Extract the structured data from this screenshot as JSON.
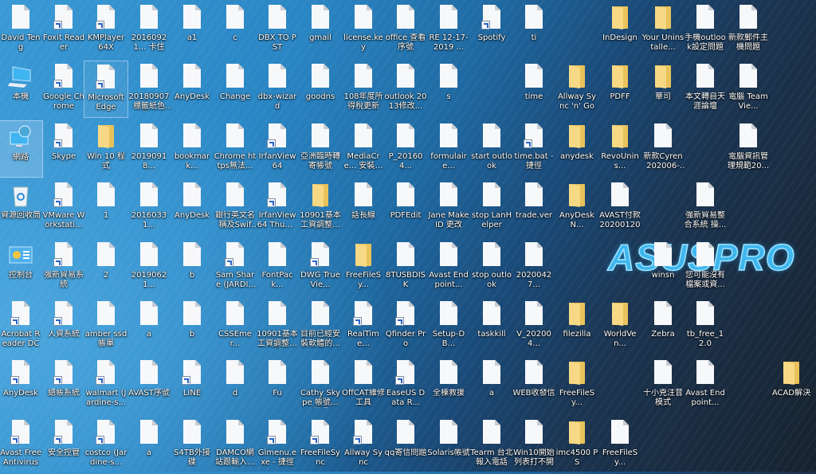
{
  "wallpaper": {
    "logo_text": "ASUSPRO",
    "accent": "#3fb6ee"
  },
  "selected": [
    "網路"
  ],
  "hovered": [
    "Microsoft Edge"
  ],
  "desktop_rows": [
    [
      {
        "label": "David Teng",
        "icon": "file"
      },
      {
        "label": "Foxit Reader",
        "icon": "file",
        "shortcut": true
      },
      {
        "label": "KMPlayer 64X",
        "icon": "file",
        "shortcut": true
      },
      {
        "label": "20160921... 卡住",
        "icon": "file"
      },
      {
        "label": "a1",
        "icon": "file"
      },
      {
        "label": "c",
        "icon": "file"
      },
      {
        "label": "DBX TO PST",
        "icon": "file"
      },
      {
        "label": "gmail",
        "icon": "file"
      },
      {
        "label": "license.key",
        "icon": "file"
      },
      {
        "label": "office 查看序號",
        "icon": "file"
      },
      {
        "label": "RE 12-17-2019 ...",
        "icon": "file"
      },
      {
        "label": "Spotify",
        "icon": "file",
        "shortcut": true
      },
      {
        "label": "ti",
        "icon": "file"
      },
      null,
      {
        "label": "InDesign",
        "icon": "folder"
      },
      {
        "label": "Your Uninstalle...",
        "icon": "folder"
      },
      {
        "label": "手機outlook設定問題",
        "icon": "file"
      },
      {
        "label": "新款郵件主機問題",
        "icon": "file"
      },
      null
    ],
    [
      {
        "label": "本機",
        "icon": "computer"
      },
      {
        "label": "Google Chrome",
        "icon": "file",
        "shortcut": true
      },
      {
        "label": "Microsoft Edge",
        "icon": "file",
        "shortcut": true
      },
      {
        "label": "20180907標籤紙色帶...",
        "icon": "file"
      },
      {
        "label": "AnyDesk",
        "icon": "file"
      },
      {
        "label": "Change",
        "icon": "file"
      },
      {
        "label": "dbx-wizard",
        "icon": "file"
      },
      {
        "label": "goodns",
        "icon": "file"
      },
      {
        "label": "108年度所得稅更新",
        "icon": "file"
      },
      {
        "label": "outlook 2013修改...",
        "icon": "file"
      },
      {
        "label": "s",
        "icon": "file"
      },
      null,
      {
        "label": "time",
        "icon": "file"
      },
      {
        "label": "Allway Sync 'n' Go",
        "icon": "folder"
      },
      {
        "label": "PDFF",
        "icon": "folder"
      },
      {
        "label": "華司",
        "icon": "folder"
      },
      {
        "label": "本文轉自天涯論壇",
        "icon": "file"
      },
      {
        "label": "電腦 TeamVie...",
        "icon": "file"
      },
      null
    ],
    [
      {
        "label": "網路",
        "icon": "network"
      },
      {
        "label": "Skype",
        "icon": "file",
        "shortcut": true
      },
      {
        "label": "Win 10 程式",
        "icon": "folder"
      },
      {
        "label": "20190918...",
        "icon": "file"
      },
      {
        "label": "bookmark...",
        "icon": "file"
      },
      {
        "label": "Chrome https無法...",
        "icon": "file"
      },
      {
        "label": "IrfanView 64",
        "icon": "file",
        "shortcut": true
      },
      {
        "label": "亞洲臨時轉寄帳號",
        "icon": "file"
      },
      {
        "label": "MediaCre... 安裝程式U...",
        "icon": "file"
      },
      {
        "label": "P_201604...",
        "icon": "file"
      },
      {
        "label": "formulaire...",
        "icon": "file"
      },
      {
        "label": "start outlook",
        "icon": "file"
      },
      {
        "label": "time.bat - 捷徑",
        "icon": "file",
        "shortcut": true
      },
      {
        "label": "anydesk",
        "icon": "folder"
      },
      {
        "label": "RevoUnins...",
        "icon": "folder"
      },
      {
        "label": "新款Cyren 202006-2...",
        "icon": "file"
      },
      null,
      {
        "label": "電腦資訊管理規範20...",
        "icon": "file"
      },
      null
    ],
    [
      {
        "label": "資源回收筒",
        "icon": "recycle-bin"
      },
      {
        "label": "VMware Workstati...",
        "icon": "file",
        "shortcut": true
      },
      {
        "label": "1",
        "icon": "file"
      },
      {
        "label": "20160331...",
        "icon": "file"
      },
      {
        "label": "AnyDesk",
        "icon": "file"
      },
      {
        "label": "銀行英文名稱及Swift...",
        "icon": "file"
      },
      {
        "label": "IrfanView 64 Thumbnails",
        "icon": "file",
        "shortcut": true
      },
      {
        "label": "10901基本工資調整更新",
        "icon": "folder"
      },
      {
        "label": "話長線",
        "icon": "file"
      },
      {
        "label": "PDFEdit",
        "icon": "file"
      },
      {
        "label": "Jane MakeID 更改",
        "icon": "file"
      },
      {
        "label": "stop LanHelper",
        "icon": "file"
      },
      {
        "label": "trade.ver",
        "icon": "file"
      },
      {
        "label": "AnyDeskN...",
        "icon": "folder"
      },
      {
        "label": "AVAST付款 20200120",
        "icon": "file"
      },
      null,
      {
        "label": "強新貿易整合系統 操...",
        "icon": "file"
      },
      null,
      null
    ],
    [
      {
        "label": "控制台",
        "icon": "control-panel"
      },
      {
        "label": "強新貿易系統",
        "icon": "file",
        "shortcut": true
      },
      {
        "label": "2",
        "icon": "file"
      },
      {
        "label": "20190621...",
        "icon": "file"
      },
      {
        "label": "b",
        "icon": "file"
      },
      {
        "label": "Sam Share (JARDINE...",
        "icon": "file",
        "shortcut": true
      },
      {
        "label": "FontPack...",
        "icon": "file"
      },
      {
        "label": "DWG TrueVie...",
        "icon": "file",
        "shortcut": true
      },
      {
        "label": "FreeFileSy...",
        "icon": "folder"
      },
      {
        "label": "8TUSBDISK",
        "icon": "file"
      },
      {
        "label": "Avast Endpoint...",
        "icon": "file"
      },
      {
        "label": "stop outlook",
        "icon": "file"
      },
      {
        "label": "20200427...",
        "icon": "file"
      },
      null,
      null,
      {
        "label": "winsn",
        "icon": "file"
      },
      {
        "label": "您可能沒有檔案或資...",
        "icon": "file"
      },
      null,
      null
    ],
    [
      {
        "label": "Acrobat Reader DC",
        "icon": "file",
        "shortcut": true
      },
      {
        "label": "人資系統",
        "icon": "file",
        "shortcut": true
      },
      {
        "label": "amber ssd 帳單",
        "icon": "file"
      },
      {
        "label": "a",
        "icon": "file"
      },
      {
        "label": "b",
        "icon": "file"
      },
      {
        "label": "CSSEmer...",
        "icon": "file"
      },
      {
        "label": "10901基本工資調整更新",
        "icon": "file"
      },
      {
        "label": "目前已經安裝軟體的...",
        "icon": "file"
      },
      {
        "label": "RealTime...",
        "icon": "file",
        "shortcut": true
      },
      {
        "label": "Qfinder Pro",
        "icon": "file",
        "shortcut": true
      },
      {
        "label": "Setup-DB...",
        "icon": "file"
      },
      {
        "label": "taskkill",
        "icon": "file"
      },
      {
        "label": "V_202004...",
        "icon": "file"
      },
      {
        "label": "filezilla",
        "icon": "folder"
      },
      {
        "label": "WorldVen...",
        "icon": "folder"
      },
      {
        "label": "Zebra",
        "icon": "file"
      },
      {
        "label": "tb_free_12.0",
        "icon": "file"
      },
      null,
      null
    ],
    [
      {
        "label": "AnyDesk",
        "icon": "file",
        "shortcut": true
      },
      {
        "label": "總帳系統",
        "icon": "file",
        "shortcut": true
      },
      {
        "label": "walmart (Jardine-s...",
        "icon": "file",
        "shortcut": true
      },
      {
        "label": "AVAST序號",
        "icon": "file"
      },
      {
        "label": "LINE",
        "icon": "file",
        "shortcut": true
      },
      {
        "label": "d",
        "icon": "file"
      },
      {
        "label": "Fu",
        "icon": "file"
      },
      {
        "label": "Cathy Skype 帳號復原碼",
        "icon": "file"
      },
      {
        "label": "OffCAT維修工具",
        "icon": "file"
      },
      {
        "label": "EaseUS Data R...",
        "icon": "file",
        "shortcut": true
      },
      {
        "label": "全棟救援",
        "icon": "file"
      },
      {
        "label": "a",
        "icon": "file"
      },
      {
        "label": "WEB收發信",
        "icon": "file"
      },
      {
        "label": "FreeFileSy...",
        "icon": "folder"
      },
      null,
      {
        "label": "十小兇注音模式",
        "icon": "file"
      },
      {
        "label": "Avast Endpoint...",
        "icon": "file"
      },
      null,
      {
        "label": "ACAD解決",
        "icon": "folder"
      }
    ],
    [
      {
        "label": "Avast Free Antivirus",
        "icon": "file",
        "shortcut": true
      },
      {
        "label": "安全控管",
        "icon": "file",
        "shortcut": true
      },
      {
        "label": "costco (Jardine-s...",
        "icon": "file",
        "shortcut": true
      },
      {
        "label": "a",
        "icon": "file"
      },
      {
        "label": "S4TB外接碟",
        "icon": "file"
      },
      {
        "label": "DAMCO網站跟輸入資訊",
        "icon": "file"
      },
      {
        "label": "Glmenu.exe - 捷徑",
        "icon": "file",
        "shortcut": true
      },
      {
        "label": "FreeFileSync",
        "icon": "file",
        "shortcut": true
      },
      {
        "label": "Allway Sync",
        "icon": "file",
        "shortcut": true
      },
      {
        "label": "qq寄信問題",
        "icon": "file"
      },
      {
        "label": "Solaris帳號",
        "icon": "file"
      },
      {
        "label": "Tearm 台北報入電話",
        "icon": "file"
      },
      {
        "label": "Win10開始列表打不開",
        "icon": "file"
      },
      {
        "label": "imc4500 PS",
        "icon": "folder"
      },
      {
        "label": "FreeFileSy...",
        "icon": "file"
      },
      null,
      null,
      null,
      null
    ]
  ]
}
